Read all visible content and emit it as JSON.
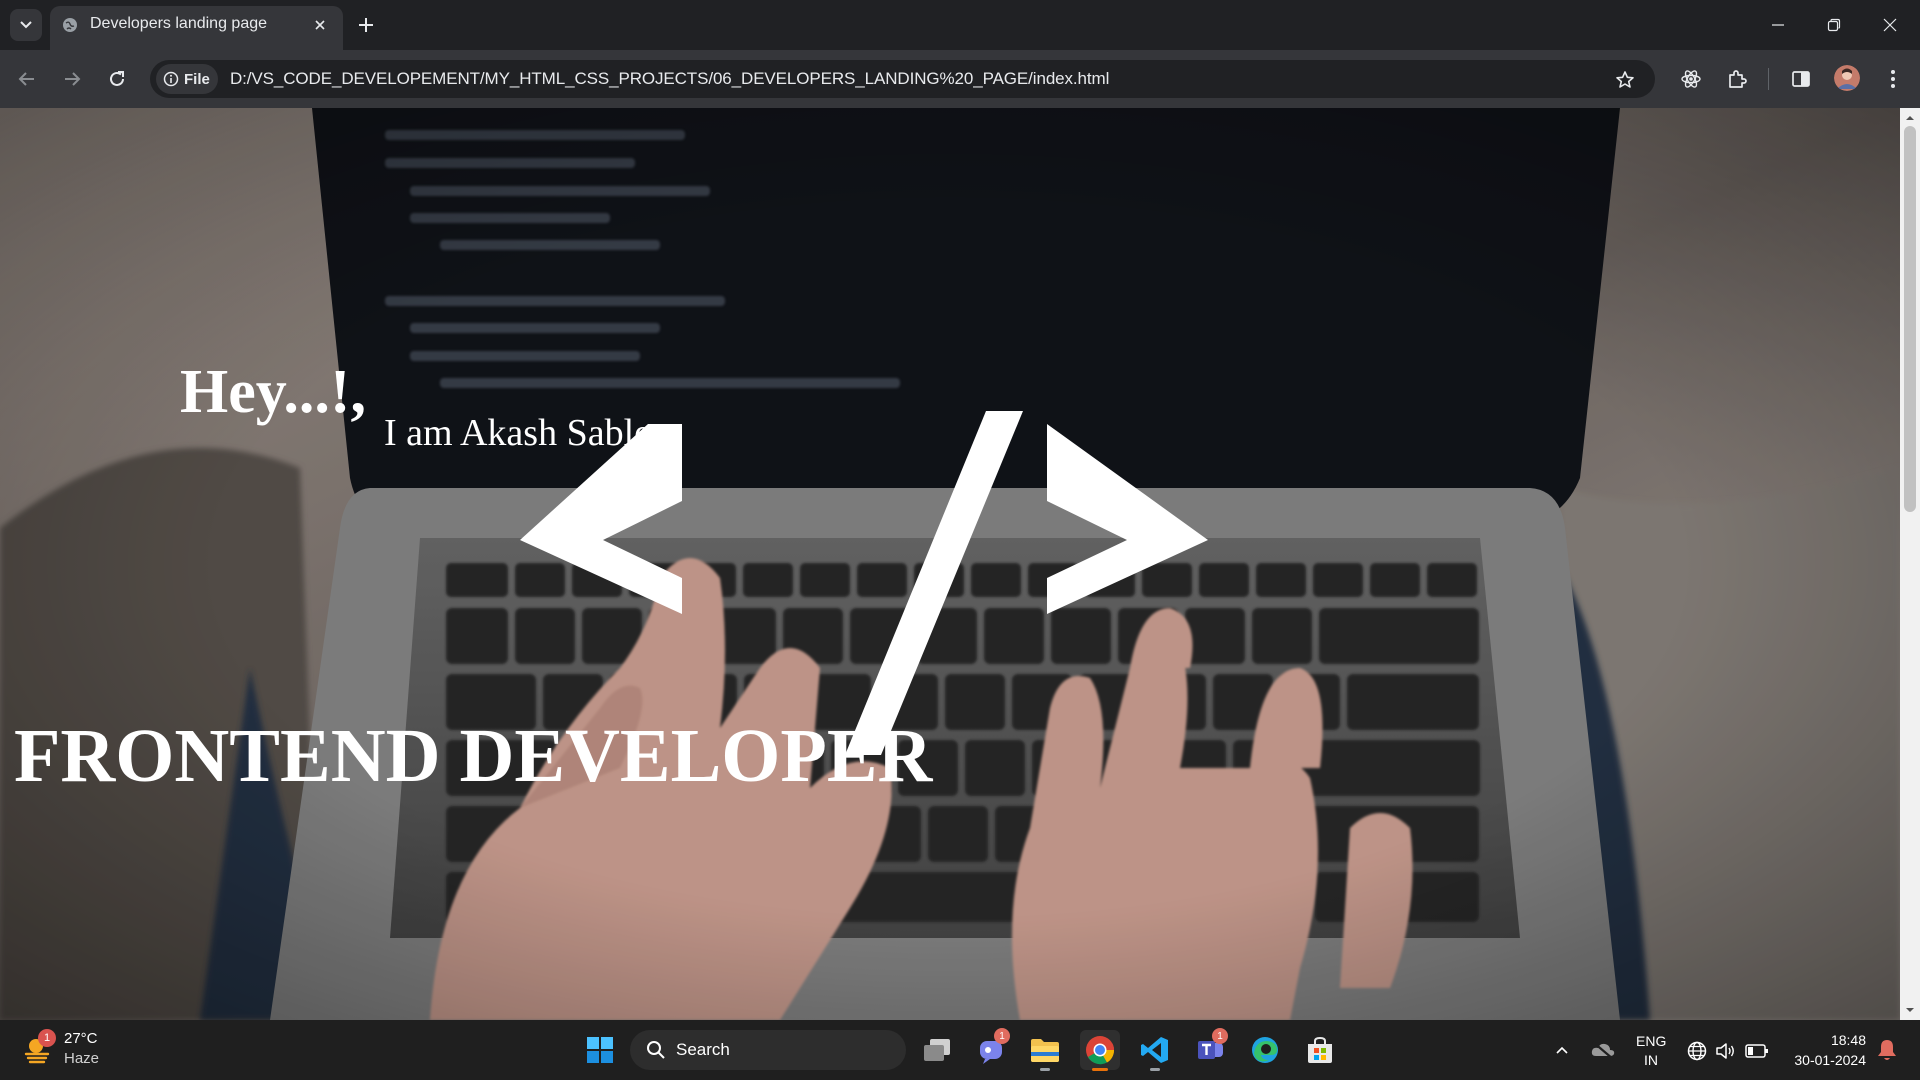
{
  "browser": {
    "tab": {
      "title": "Developers landing page",
      "favicon": "globe-icon"
    },
    "new_tab_icon": "plus-icon",
    "address": {
      "chip_label": "File",
      "url": "D:/VS_CODE_DEVELOPEMENT/MY_HTML_CSS_PROJECTS/06_DEVELOPERS_LANDING%20_PAGE/index.html"
    },
    "toolbar_icons": [
      "arrow-left-icon",
      "arrow-right-icon",
      "reload-icon",
      "star-icon",
      "react-extension-icon",
      "puzzle-icon",
      "side-panel-icon",
      "avatar",
      "more-vert-icon"
    ],
    "window_controls": [
      "minimize-icon",
      "restore-icon",
      "close-icon"
    ]
  },
  "page": {
    "greeting": "Hey...!,",
    "intro": "I am Akash Sable",
    "role": "FRONTEND DEVELOPER",
    "logo_symbol": "code-slash-icon",
    "background": "laptop-typing-photo"
  },
  "taskbar": {
    "weather": {
      "temp": "27°C",
      "condition": "Haze",
      "badge": "1"
    },
    "search_label": "Search",
    "apps": [
      {
        "name": "task-view",
        "badge": ""
      },
      {
        "name": "chat",
        "badge": "1"
      },
      {
        "name": "file-explorer",
        "badge": ""
      },
      {
        "name": "chrome",
        "badge": ""
      },
      {
        "name": "vscode",
        "badge": ""
      },
      {
        "name": "teams",
        "badge": "1"
      },
      {
        "name": "edge",
        "badge": ""
      },
      {
        "name": "microsoft-store",
        "badge": ""
      }
    ],
    "tray": {
      "lang_line1": "ENG",
      "lang_line2": "IN",
      "time": "18:48",
      "date": "30-01-2024"
    }
  },
  "colors": {
    "tab_bg": "#202124",
    "toolbar_bg": "#35363a",
    "taskbar_bg": "#1f1f1f",
    "page_text": "#ffffff",
    "chrome_indicator": "#e8710a"
  }
}
